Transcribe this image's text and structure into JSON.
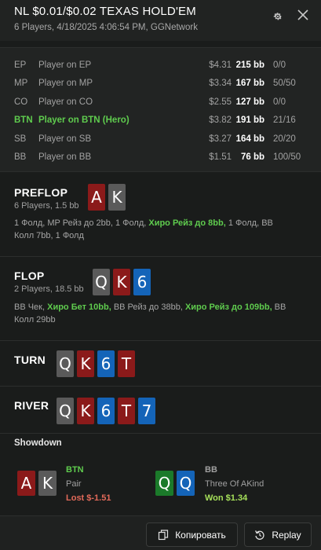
{
  "header": {
    "title": "NL $0.01/$0.02 TEXAS HOLD'EM",
    "subtitle": "6 Players, 4/18/2025 4:06:54 PM, GGNetwork"
  },
  "players": [
    {
      "pos": "EP",
      "name": "Player on EP",
      "money": "$4.31",
      "bb": "215 bb",
      "vpip": "0/0",
      "hero": false
    },
    {
      "pos": "MP",
      "name": "Player on MP",
      "money": "$3.34",
      "bb": "167 bb",
      "vpip": "50/50",
      "hero": false
    },
    {
      "pos": "CO",
      "name": "Player on CO",
      "money": "$2.55",
      "bb": "127 bb",
      "vpip": "0/0",
      "hero": false
    },
    {
      "pos": "BTN",
      "name": "Player on BTN (Hero)",
      "money": "$3.82",
      "bb": "191 bb",
      "vpip": "21/16",
      "hero": true
    },
    {
      "pos": "SB",
      "name": "Player on SB",
      "money": "$3.27",
      "bb": "164 bb",
      "vpip": "20/20",
      "hero": false
    },
    {
      "pos": "BB",
      "name": "Player on BB",
      "money": "$1.51",
      "bb": "76 bb",
      "vpip": "100/50",
      "hero": false
    }
  ],
  "preflop": {
    "label": "PREFLOP",
    "sub": "6 Players, 1.5 bb",
    "cards": [
      {
        "r": "A",
        "c": "red"
      },
      {
        "r": "K",
        "c": "gray"
      }
    ],
    "actions": [
      {
        "t": "1 Фолд, MP Рейз до 2bb, 1 Фолд, ",
        "h": false
      },
      {
        "t": "Хиро Рейз до 8bb,",
        "h": true
      },
      {
        "t": " 1 Фолд, BB Колл 7bb, 1 Фолд",
        "h": false
      }
    ]
  },
  "flop": {
    "label": "FLOP",
    "sub": "2 Players, 18.5 bb",
    "cards": [
      {
        "r": "Q",
        "c": "gray"
      },
      {
        "r": "K",
        "c": "red"
      },
      {
        "r": "6",
        "c": "blue"
      }
    ],
    "actions": [
      {
        "t": "BB Чек, ",
        "h": false
      },
      {
        "t": "Хиро Бет 10bb,",
        "h": true
      },
      {
        "t": " BB Рейз до 38bb, ",
        "h": false
      },
      {
        "t": "Хиро Рейз до 109bb,",
        "h": true
      },
      {
        "t": " BB Колл 29bb",
        "h": false
      }
    ]
  },
  "turn": {
    "label": "TURN",
    "cards": [
      {
        "r": "Q",
        "c": "gray"
      },
      {
        "r": "K",
        "c": "red"
      },
      {
        "r": "6",
        "c": "blue"
      },
      {
        "r": "T",
        "c": "red"
      }
    ]
  },
  "river": {
    "label": "RIVER",
    "cards": [
      {
        "r": "Q",
        "c": "gray"
      },
      {
        "r": "K",
        "c": "red"
      },
      {
        "r": "6",
        "c": "blue"
      },
      {
        "r": "T",
        "c": "red"
      },
      {
        "r": "7",
        "c": "blue"
      }
    ]
  },
  "showdown": {
    "title": "Showdown",
    "players": [
      {
        "pos": "BTN",
        "hand": "Pair",
        "result": "Lost $-1.51",
        "posColor": "#5fcc4e",
        "resColor": "#e36a5a",
        "cards": [
          {
            "r": "A",
            "c": "red"
          },
          {
            "r": "K",
            "c": "gray"
          }
        ]
      },
      {
        "pos": "BB",
        "hand": "Three Of AKind",
        "result": "Won $1.34",
        "posColor": "#a0a0a0",
        "resColor": "#a6e05a",
        "cards": [
          {
            "r": "Q",
            "c": "green"
          },
          {
            "r": "Q",
            "c": "blue"
          }
        ]
      }
    ]
  },
  "buttons": {
    "copy_label": "Копировать",
    "replay_label": "Replay"
  },
  "icons": {
    "settings": "gear-icon",
    "close": "close-icon",
    "copy": "copy-icon",
    "replay": "replay-icon"
  }
}
